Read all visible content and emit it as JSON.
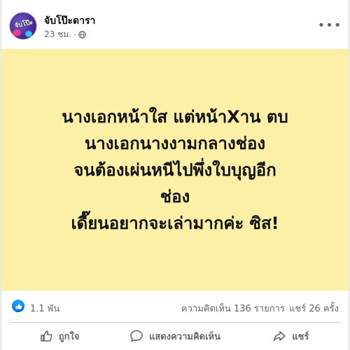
{
  "post": {
    "page_name": "จับโป๊ะดารา",
    "time": "23 ชม.",
    "separator": "·",
    "avatar_text": "จับโป๊ะ",
    "image_lines": [
      "นางเอกหน้าใส แต่หน้าXาน ตบ",
      "นางเอกนางงามกลางช่อง",
      "จนต้องเผ่นหนีไปพึ่งใบบุญอีก",
      "ช่อง",
      "เดี๊ยนอยากจะเล่ามากค่ะ ซิส!"
    ],
    "image_bg": "#fcf0a6"
  },
  "stats": {
    "reactions": "1.1 พัน",
    "comments": "ความคิดเห็น 136 รายการ",
    "shares": "แชร์ 26 ครั้ง"
  },
  "actions": {
    "like": "ถูกใจ",
    "comment": "แสดงความคิดเห็น",
    "share": "แชร์"
  },
  "icons": {
    "globe": "globe-icon",
    "more": "more-options-icon",
    "like": "thumbs-up-icon",
    "comment": "comment-icon",
    "share": "share-icon"
  },
  "colors": {
    "accent": "#1877f2",
    "secondary_text": "#65676b"
  }
}
